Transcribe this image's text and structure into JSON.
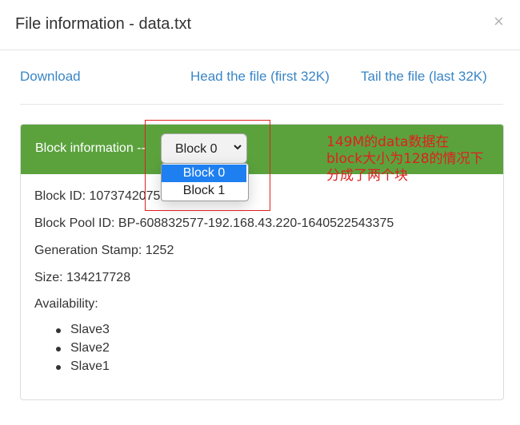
{
  "modal": {
    "title": "File information - data.txt",
    "close_symbol": "×"
  },
  "links": {
    "download": "Download",
    "head": "Head the file (first 32K)",
    "tail": "Tail the file (last 32K)"
  },
  "panel": {
    "heading_label": "Block information --",
    "select_value": "Block 0",
    "select_options": [
      "Block 0",
      "Block 1"
    ],
    "block_id": "Block ID: 1073742075",
    "block_pool_id": "Block Pool ID: BP-608832577-192.168.43.220-1640522543375",
    "generation_stamp": "Generation Stamp: 1252",
    "size": "Size: 134217728",
    "availability_label": "Availability:",
    "availability": [
      "Slave3",
      "Slave2",
      "Slave1"
    ]
  },
  "annotation": {
    "lines": [
      "149M的data数据在",
      "block大小为128的情况下",
      "分成了两个块"
    ],
    "color": "#e02020"
  },
  "colors": {
    "heading_green": "#5ba23d",
    "link_blue": "#3a86c6",
    "selected_option": "#1e7ff0"
  }
}
